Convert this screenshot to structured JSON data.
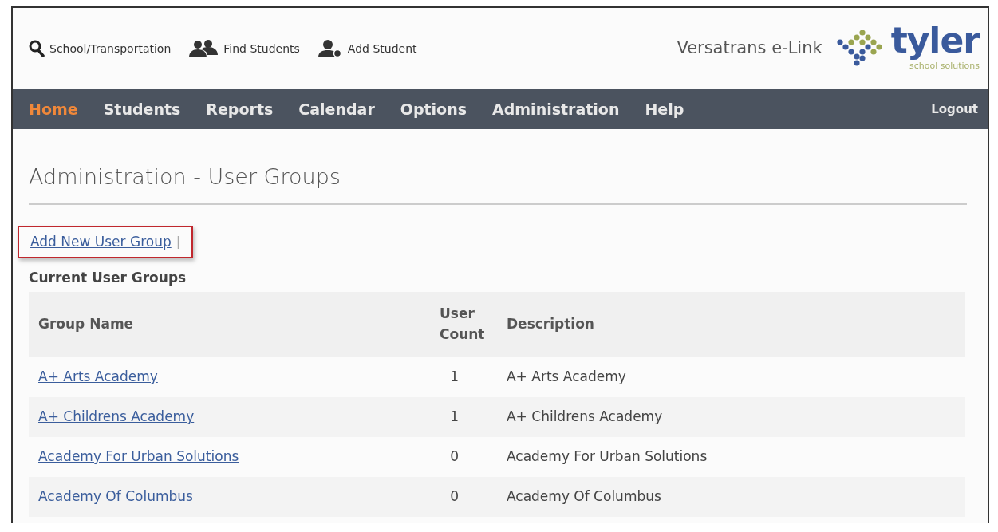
{
  "toolbar": [
    {
      "kind": "search",
      "label": "School/Transportation"
    },
    {
      "kind": "group",
      "label": "Find Students"
    },
    {
      "kind": "add",
      "label": "Add Student"
    }
  ],
  "app_name": "Versatrans e-Link",
  "logo": {
    "name": "tyler",
    "tagline": "school solutions"
  },
  "nav": [
    {
      "label": "Home",
      "selected": true
    },
    {
      "label": "Students",
      "selected": false
    },
    {
      "label": "Reports",
      "selected": false
    },
    {
      "label": "Calendar",
      "selected": false
    },
    {
      "label": "Options",
      "selected": false
    },
    {
      "label": "Administration",
      "selected": false
    },
    {
      "label": "Help",
      "selected": false
    }
  ],
  "logout": "Logout",
  "page_title": "Administration - User Groups",
  "actions": {
    "link": "Add New User Group",
    "separator": "|",
    "highlighted": true
  },
  "section_title": "Current User Groups",
  "table": {
    "columns": [
      "Group Name",
      "User Count",
      "Description"
    ],
    "rows": [
      [
        "A+ Arts Academy",
        "1",
        "A+ Arts Academy"
      ],
      [
        "A+ Childrens Academy",
        "1",
        "A+ Childrens Academy"
      ],
      [
        "Academy For Urban Solutions",
        "0",
        "Academy For Urban Solutions"
      ],
      [
        "Academy Of Columbus",
        "0",
        "Academy Of Columbus"
      ]
    ]
  }
}
